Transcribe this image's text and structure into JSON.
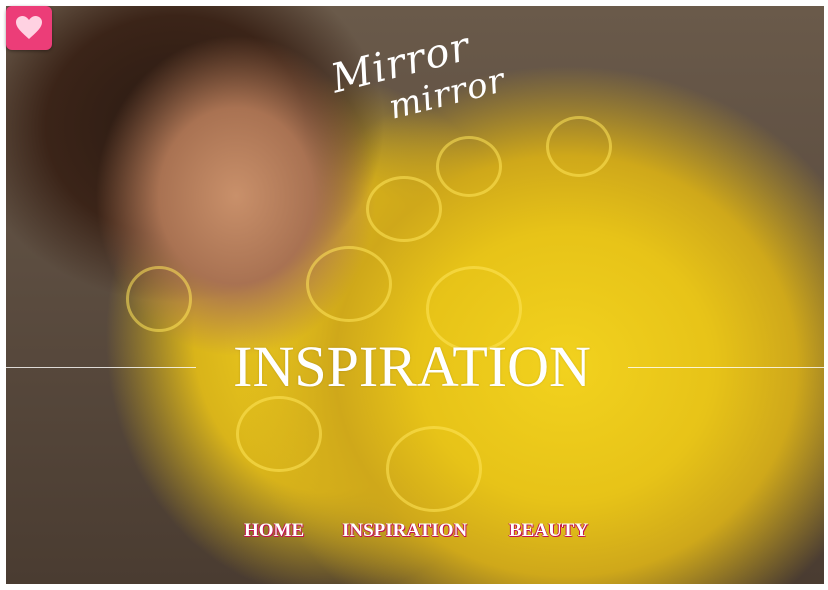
{
  "logo": {
    "line1": "Mirror",
    "line2": "mirror"
  },
  "favorite": {
    "icon": "heart-icon",
    "color": "#ec3d78"
  },
  "hero": {
    "headline": "INSPIRATION"
  },
  "nav": {
    "items": [
      {
        "label": "HOME"
      },
      {
        "label": "INSPIRATION"
      },
      {
        "label": "BEAUTY"
      }
    ],
    "accent_color": "#c4134f"
  }
}
